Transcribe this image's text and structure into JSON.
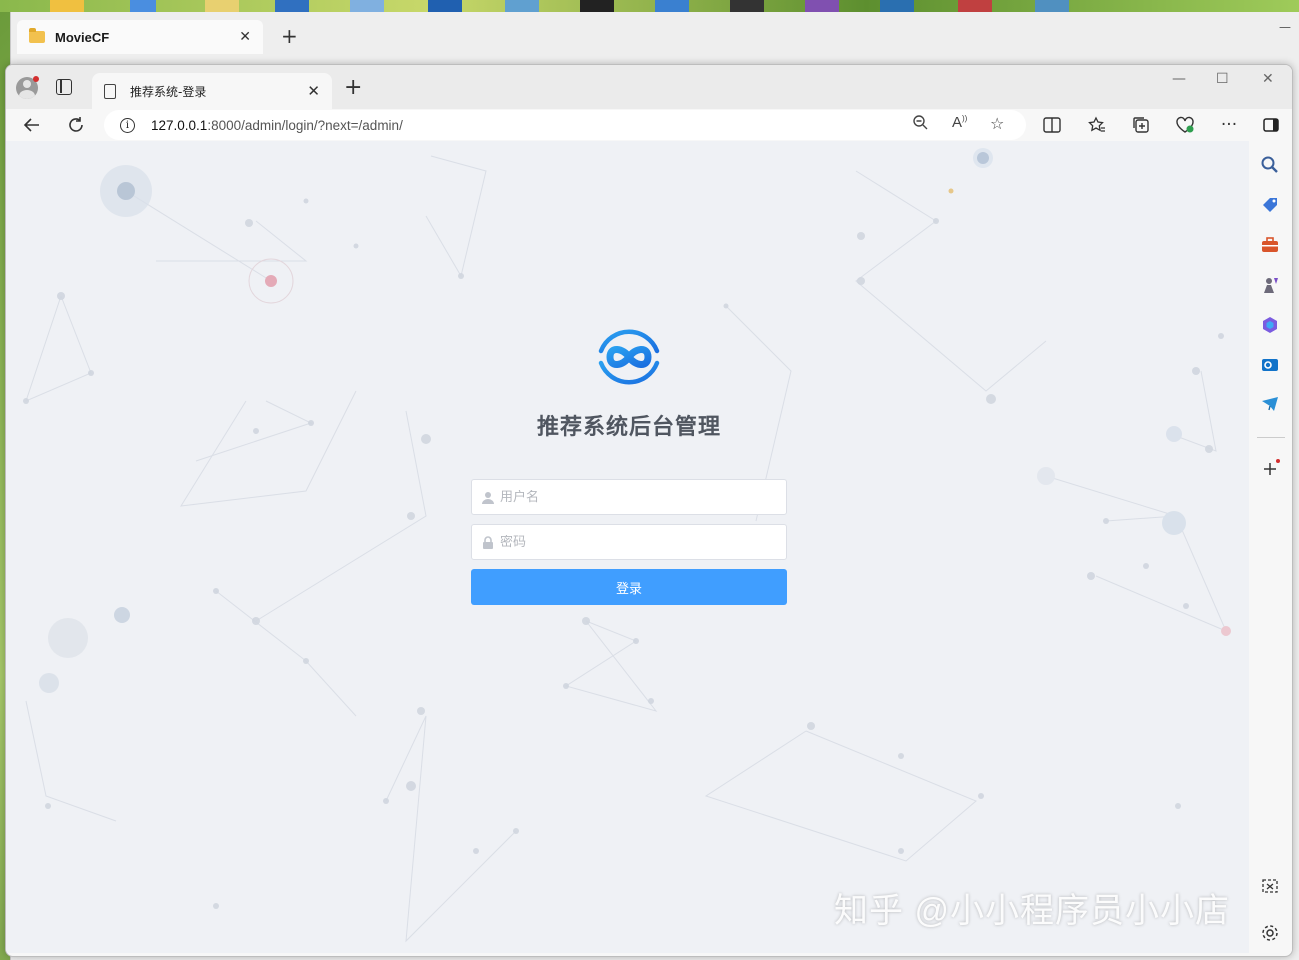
{
  "explorer": {
    "tab_title": "MovieCF",
    "close_glyph": "✕",
    "new_tab_glyph": "+"
  },
  "browser": {
    "tab_title": "推荐系统-登录",
    "tab_close_glyph": "✕",
    "new_tab_glyph": "+",
    "window_controls": [
      "—",
      "☐",
      "✕"
    ],
    "address": {
      "host": "127.0.0.1",
      "path": ":8000/admin/login/?next=/admin/"
    }
  },
  "login": {
    "title": "推荐系统后台管理",
    "username_placeholder": "用户名",
    "password_placeholder": "密码",
    "submit_label": "登录",
    "accent_color": "#409eff"
  },
  "sidebar": {
    "icons": [
      "search-icon",
      "shopping-tag-icon",
      "toolbox-icon",
      "games-icon",
      "copilot-icon",
      "outlook-icon",
      "telegram-icon",
      "add-icon",
      "screenshot-icon",
      "settings-icon"
    ]
  },
  "watermark": "知乎 @小小程序员小小店"
}
